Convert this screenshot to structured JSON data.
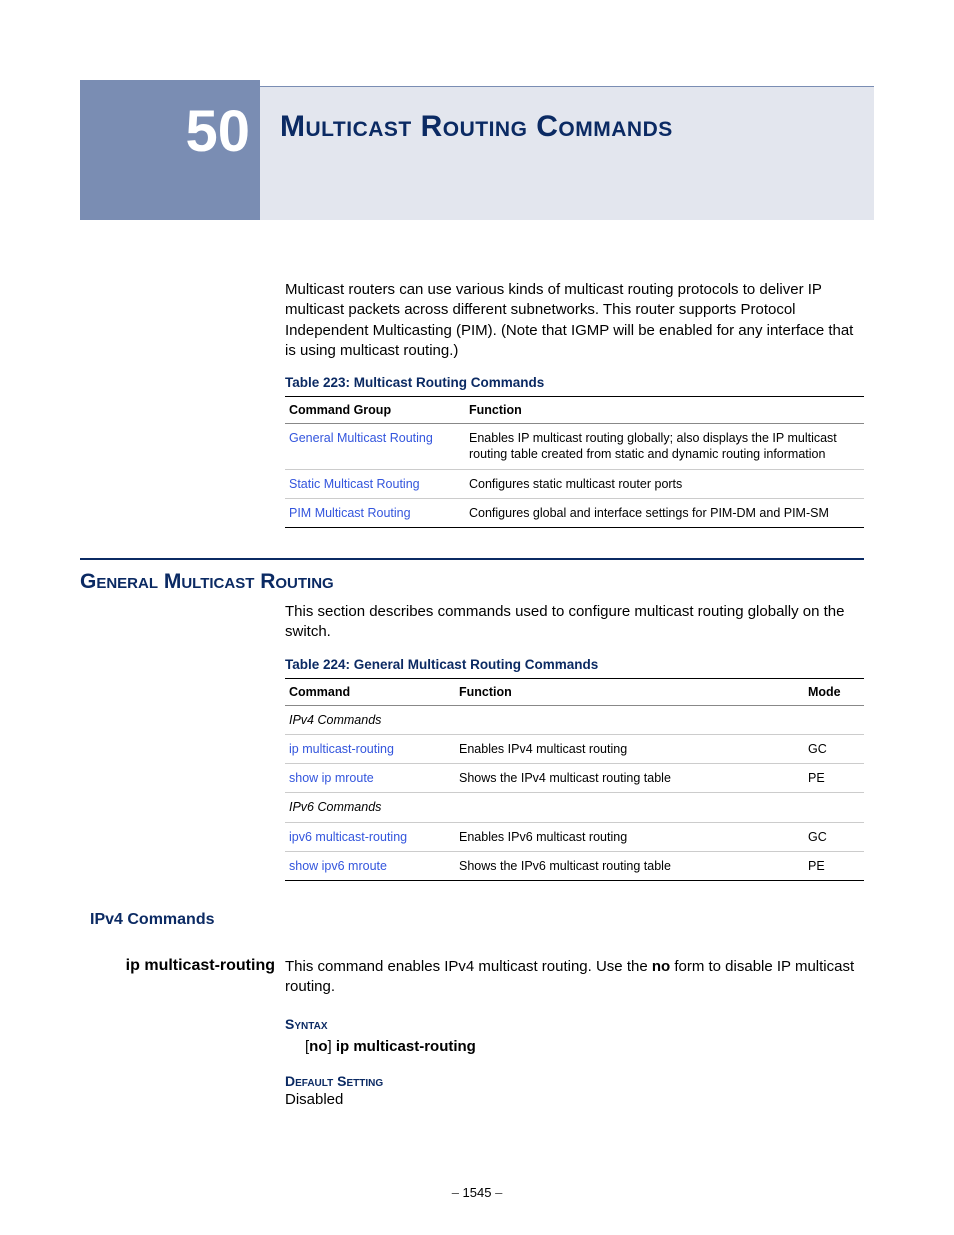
{
  "chapter": {
    "number": "50",
    "title": "Multicast Routing Commands"
  },
  "intro": "Multicast routers can use various kinds of multicast routing protocols to deliver IP multicast packets across different subnetworks. This router supports Protocol Independent Multicasting (PIM). (Note that IGMP will be enabled for any interface that is using multicast routing.)",
  "table223": {
    "caption": "Table 223: Multicast Routing Commands",
    "head": {
      "c1": "Command Group",
      "c2": "Function"
    },
    "rows": [
      {
        "group": "General Multicast Routing",
        "func": "Enables IP multicast routing globally; also displays the IP multicast routing table created from static and dynamic routing information"
      },
      {
        "group": "Static Multicast Routing",
        "func": "Configures static multicast router ports"
      },
      {
        "group": "PIM Multicast Routing",
        "func": "Configures global and interface settings for PIM-DM and PIM-SM"
      }
    ]
  },
  "section1": {
    "heading": "General Multicast Routing",
    "intro": "This section describes commands used to configure multicast routing globally on the switch."
  },
  "table224": {
    "caption": "Table 224: General Multicast Routing Commands",
    "head": {
      "c1": "Command",
      "c2": "Function",
      "c3": "Mode"
    },
    "sub1": "IPv4 Commands",
    "rows1": [
      {
        "cmd": "ip multicast-routing",
        "func": "Enables IPv4 multicast routing",
        "mode": "GC"
      },
      {
        "cmd": "show ip mroute",
        "func": "Shows the IPv4 multicast routing table",
        "mode": "PE"
      }
    ],
    "sub2": "IPv6 Commands",
    "rows2": [
      {
        "cmd": "ipv6 multicast-routing",
        "func": "Enables IPv6 multicast routing",
        "mode": "GC"
      },
      {
        "cmd": "show ipv6 mroute",
        "func": "Shows the IPv6 multicast routing table",
        "mode": "PE"
      }
    ]
  },
  "ipv4_label": "IPv4 Commands",
  "cmd1": {
    "name": "ip multicast-routing",
    "desc_pre": "This command enables IPv4 multicast routing. Use the ",
    "desc_bold": "no",
    "desc_post": " form to disable IP multicast routing.",
    "syntax_label": "Syntax",
    "syntax_open": "[",
    "syntax_no": "no",
    "syntax_close": "] ",
    "syntax_cmd": "ip multicast-routing",
    "default_label": "Default Setting",
    "default_value": "Disabled"
  },
  "footer": {
    "dash1": "–  ",
    "page": "1545",
    "dash2": "  –"
  }
}
